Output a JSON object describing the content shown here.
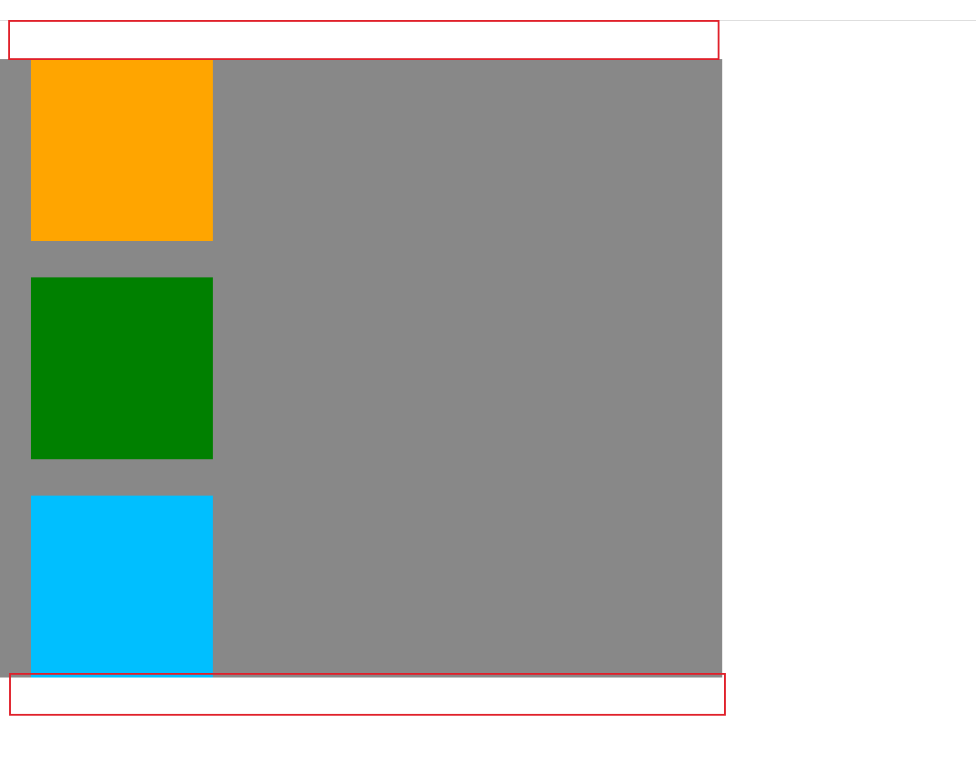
{
  "colors": {
    "background": "#ffffff",
    "rule": "#dddddd",
    "panel": "#888888",
    "outline": "#e0202a"
  },
  "squares": [
    {
      "name": "orange-square",
      "color": "#ffa500"
    },
    {
      "name": "green-square",
      "color": "#008000"
    },
    {
      "name": "cyan-square",
      "color": "#00bfff"
    }
  ]
}
